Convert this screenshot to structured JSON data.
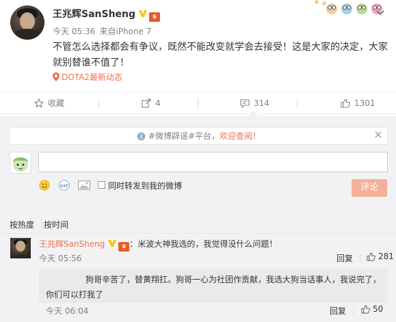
{
  "post": {
    "username": "王兆辉SanSheng",
    "verified_icon": "vip-v-icon",
    "level_badge": "6",
    "time": "今天 05:36",
    "source_prefix": "来自",
    "source": "iPhone 7",
    "content": "不管怎么选择都会有争议，既然不能改变就学会去接受！这是大家的决定，大家就别替谁不值了！",
    "topic": "DOTA2最新动态"
  },
  "actions": {
    "favorite": "收藏",
    "forward_count": "4",
    "comment_count": "314",
    "like_count": "1301"
  },
  "comments_panel": {
    "notice_prefix": "#微博辟谣#平台，",
    "notice_link": "欢迎查阅！",
    "forward_label": "同时转发到我的微博",
    "submit_label": "评论",
    "sort_hot": "按热度",
    "sort_time": "按时间"
  },
  "comments": [
    {
      "author": "王兆辉SanSheng",
      "badge": "6",
      "text": "：米波大神我选的，我觉得没什么问题！",
      "time": "今天 05:56",
      "reply": "回复",
      "likes": "281"
    },
    {
      "text": "狗哥辛苦了，替黄翔扛。狗哥一心为社团作贡献，我选大狗当话事人，我说完了，你们可以打我了",
      "time": "今天 06:04",
      "reply": "回复",
      "likes": "50"
    }
  ],
  "colors": {
    "link": "#eb7350",
    "verified": "#ffc000",
    "panel_bg": "#f2f2f5",
    "submit_bg": "#f6b09a"
  }
}
